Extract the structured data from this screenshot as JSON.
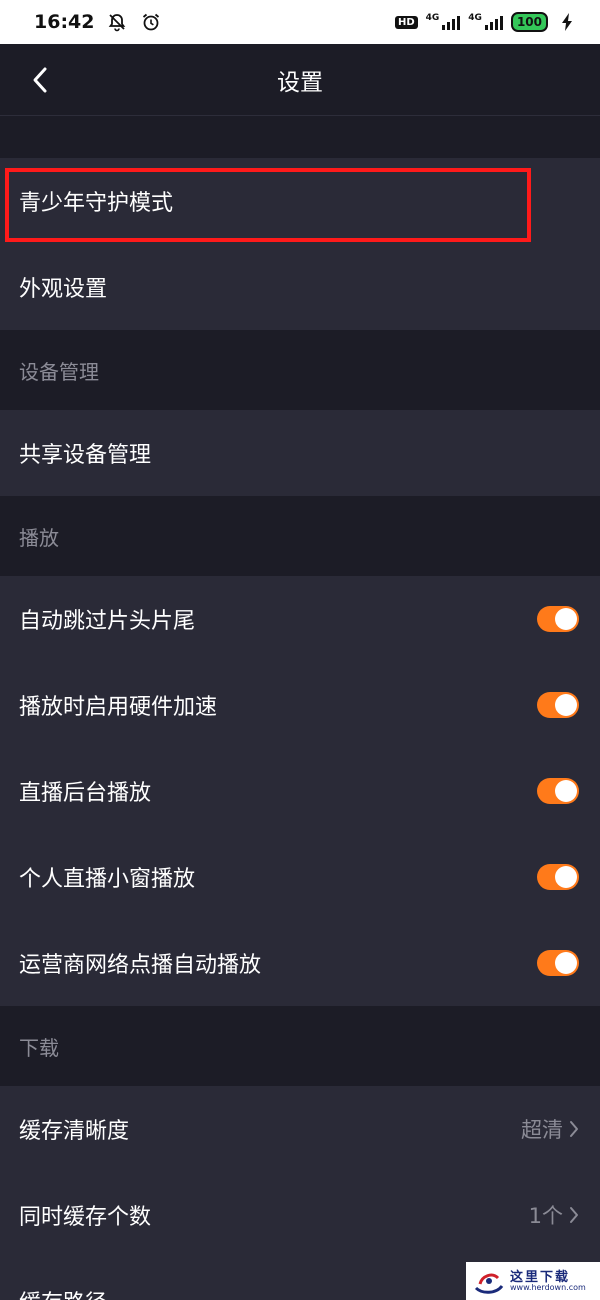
{
  "status_bar": {
    "time": "16:42",
    "hd": "HD",
    "network1": "4G",
    "network2": "4G",
    "battery": "100",
    "icons": [
      "mute-bell-icon",
      "alarm-icon",
      "signal-icon",
      "charging-icon"
    ]
  },
  "header": {
    "title": "设置",
    "back_icon": "chevron-left-icon"
  },
  "sections": {
    "top": {
      "items": [
        {
          "label": "青少年守护模式"
        },
        {
          "label": "外观设置"
        }
      ]
    },
    "device": {
      "title": "设备管理",
      "items": [
        {
          "label": "共享设备管理"
        }
      ]
    },
    "playback": {
      "title": "播放",
      "items": [
        {
          "label": "自动跳过片头片尾",
          "enabled": true
        },
        {
          "label": "播放时启用硬件加速",
          "enabled": true
        },
        {
          "label": "直播后台播放",
          "enabled": true
        },
        {
          "label": "个人直播小窗播放",
          "enabled": true
        },
        {
          "label": "运营商网络点播自动播放",
          "enabled": true
        }
      ]
    },
    "download": {
      "title": "下载",
      "items": [
        {
          "label": "缓存清晰度",
          "value": "超清"
        },
        {
          "label": "同时缓存个数",
          "value": "1个"
        },
        {
          "label": "缓存路径"
        }
      ]
    }
  },
  "colors": {
    "background": "#1c1c26",
    "row": "#2a2a37",
    "accent": "#ff7a1a",
    "highlight": "#ff1a1a",
    "muted_text": "#8b8b96"
  },
  "watermark": {
    "cn": "这里下载",
    "url": "www.herdown.com"
  }
}
